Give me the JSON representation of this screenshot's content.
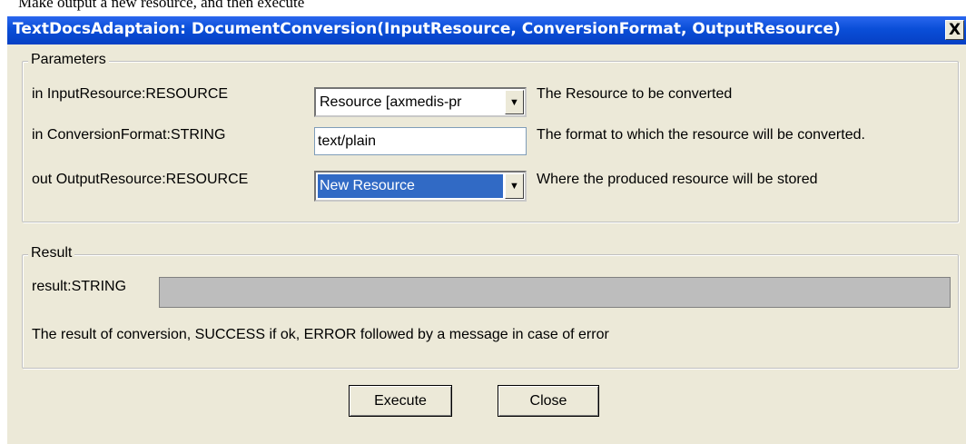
{
  "caption": "Make output a new resource, and then execute",
  "window": {
    "title": "TextDocsAdaptaion: DocumentConversion(InputResource, ConversionFormat, OutputResource)",
    "close_label": "X"
  },
  "parameters": {
    "legend": "Parameters",
    "rows": [
      {
        "label": "in InputResource:RESOURCE",
        "value": "Resource [axmedis-pr",
        "description": "The Resource to be converted"
      },
      {
        "label": "in ConversionFormat:STRING",
        "value": "text/plain",
        "description": "The format to which the resource will be converted."
      },
      {
        "label": "out OutputResource:RESOURCE",
        "value": "New Resource",
        "description": "Where the produced resource will be stored"
      }
    ]
  },
  "result": {
    "legend": "Result",
    "label": "result:STRING",
    "value": "",
    "description": "The result of conversion, SUCCESS if ok, ERROR followed by a message in case of error"
  },
  "buttons": {
    "execute": "Execute",
    "close": "Close"
  },
  "colors": {
    "titlebar": "#0a4ed8",
    "dialog_bg": "#ece9d8",
    "selection": "#316ac5"
  },
  "icons": {
    "combo_arrow": "chevron-down-icon"
  }
}
